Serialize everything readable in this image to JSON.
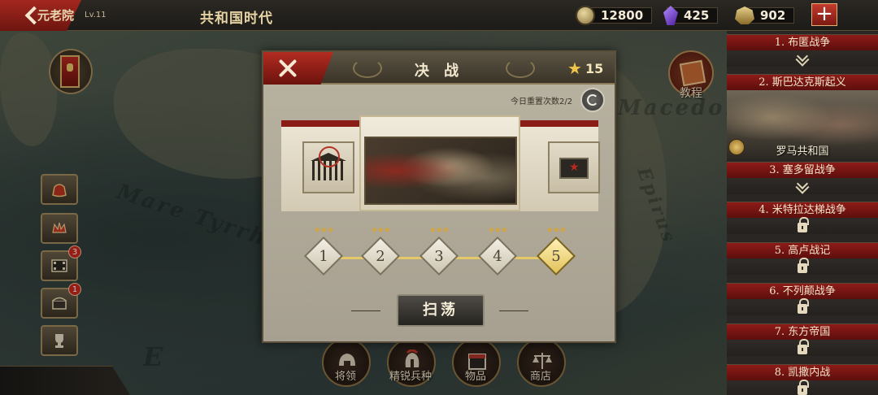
{
  "header": {
    "era_title": "共和国时代",
    "resources": [
      {
        "name": "coin",
        "value": "12800"
      },
      {
        "name": "gem",
        "value": "425"
      },
      {
        "name": "helmet",
        "value": "902"
      }
    ],
    "add_label": "+"
  },
  "map": {
    "labels": [
      "Mare Tyrrh",
      "Macedon",
      "Epirus",
      "E"
    ]
  },
  "sidebar": {
    "badges": {
      "video": "3",
      "chest": "1"
    },
    "senate_label": "元老院",
    "senate_level": "Lv.11"
  },
  "tutorial_label": "教程",
  "campaigns": [
    {
      "label": "1. 布匿战争",
      "state": "expand"
    },
    {
      "label": "2. 斯巴达克斯起义",
      "state": "selected",
      "faction": "罗马共和国"
    },
    {
      "label": "3. 塞多留战争",
      "state": "expand"
    },
    {
      "label": "4. 米特拉达梯战争",
      "state": "locked"
    },
    {
      "label": "5. 高卢战记",
      "state": "locked"
    },
    {
      "label": "6. 不列颠战争",
      "state": "locked"
    },
    {
      "label": "7. 东方帝国",
      "state": "locked"
    },
    {
      "label": "8. 凯撒内战",
      "state": "locked"
    }
  ],
  "bottom_menu": [
    "将领",
    "精锐兵种",
    "物品",
    "商店"
  ],
  "modal": {
    "title": "决 战",
    "star_total": "15",
    "reset_text": "今日重置次数2/2",
    "levels": [
      {
        "num": "1",
        "stars": 3
      },
      {
        "num": "2",
        "stars": 3
      },
      {
        "num": "3",
        "stars": 3
      },
      {
        "num": "4",
        "stars": 3
      },
      {
        "num": "5",
        "stars": 3,
        "current": true
      }
    ],
    "sweep_label": "扫荡"
  },
  "colors": {
    "accent_red": "#8d1b18",
    "gold": "#e4c86a",
    "panel": "#b9b3a2"
  }
}
